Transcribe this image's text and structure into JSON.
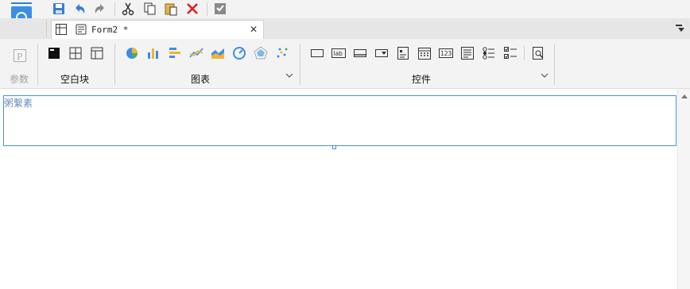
{
  "tab": {
    "title": "Form2 *",
    "close": "✕"
  },
  "ribbon": {
    "param_label": "参数",
    "blank_block_label": "空白块",
    "chart_label": "图表",
    "control_label": "控件",
    "label_widget_text": "lab",
    "number_widget_text": "123"
  },
  "canvas": {
    "block_label": "粥繫素"
  },
  "colors": {
    "accent": "#4a90d9",
    "ribbon_bg": "#f3f3f3"
  }
}
